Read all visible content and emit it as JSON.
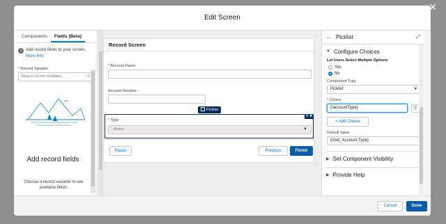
{
  "modal": {
    "title": "Edit Screen"
  },
  "left_panel": {
    "tabs": [
      {
        "label": "Components"
      },
      {
        "label": "Fields (Beta)"
      }
    ],
    "info_text": "Add record fields to your screen.",
    "info_link": "More Info",
    "record_variable_label": "Record Variable",
    "record_variable_placeholder": "Search record variables...",
    "empty_title": "Add record fields",
    "empty_desc": "Choose a record variable to see available fields."
  },
  "canvas": {
    "card_title": "Record Screen",
    "fields": [
      {
        "label": "Account Name",
        "required": true
      },
      {
        "label": "Account Number",
        "required": false
      }
    ],
    "picklist_badge": "Picklist",
    "type_label": "Type",
    "type_value": "--None--",
    "pause_label": "Pause",
    "previous_label": "Previous",
    "finish_label": "Finish"
  },
  "right_panel": {
    "title": "Picklist",
    "configure_choices": "Configure Choices",
    "multi_select_label": "Let Users Select Multiple Options",
    "radio_yes": "Yes",
    "radio_no": "No",
    "component_type_label": "Component Type",
    "component_type_value": "Picklist",
    "choice_label": "Choice",
    "choice_value": "{!accountType}",
    "add_choice_label": "Add Choice",
    "default_value_label": "Default Value",
    "default_value": "{!Get_Account.Type}",
    "visibility_section": "Set Component Visibility",
    "help_section": "Provide Help"
  },
  "footer": {
    "cancel_label": "Cancel",
    "done_label": "Done"
  },
  "colors": {
    "brand": "#0176d3",
    "primary_button": "#0b5cab",
    "selection": "#032d60"
  }
}
